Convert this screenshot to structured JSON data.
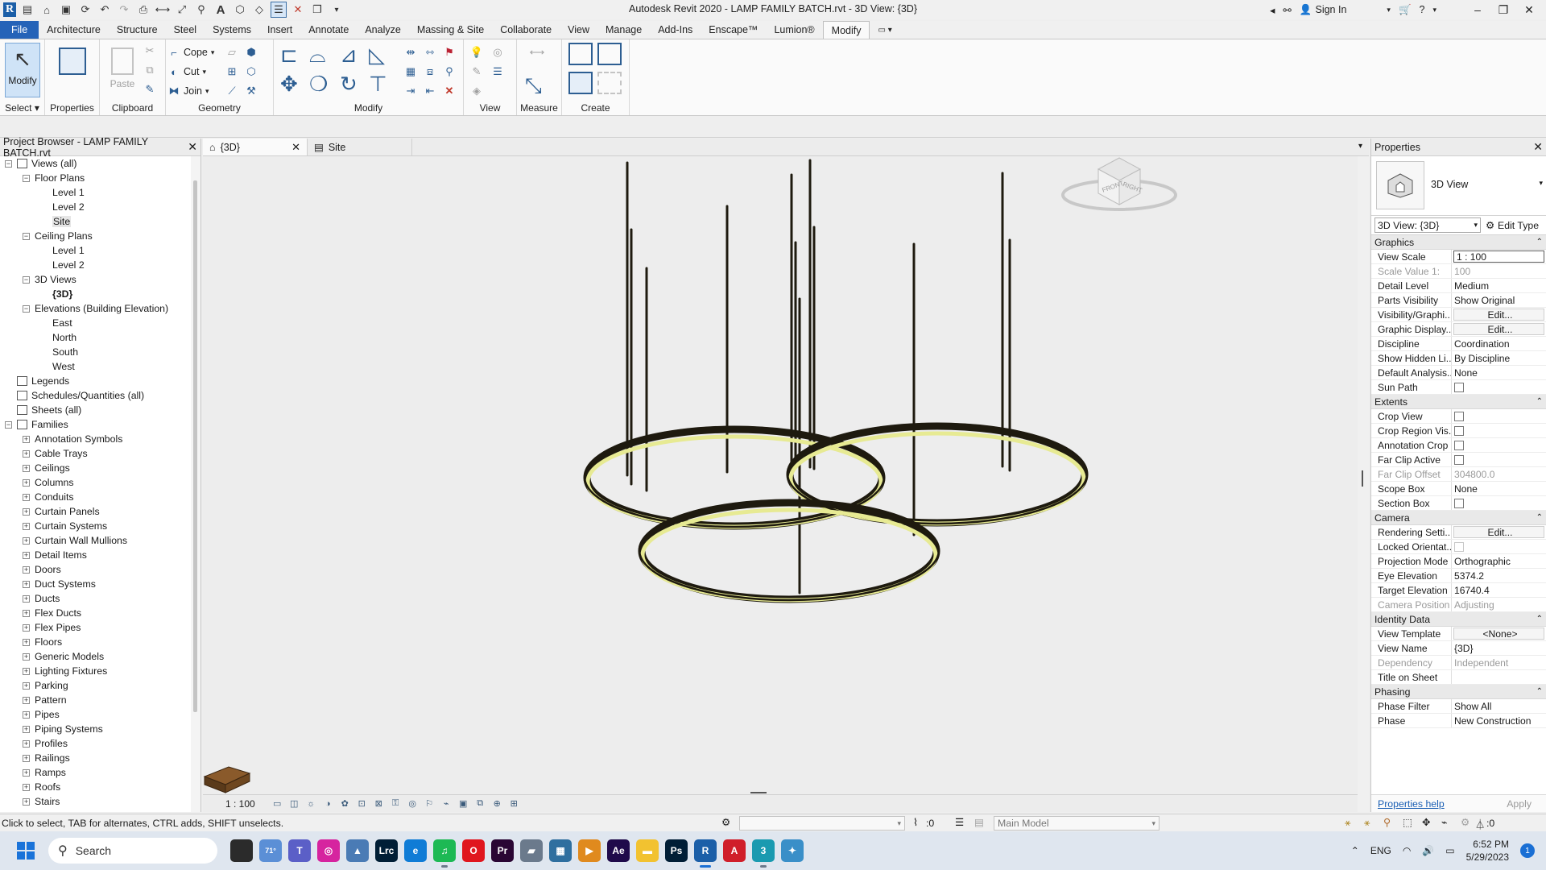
{
  "app": {
    "title": "Autodesk Revit 2020 - LAMP FAMILY BATCH.rvt - 3D View: {3D}",
    "sign_in": "Sign In"
  },
  "ribbon": {
    "tabs": [
      "File",
      "Architecture",
      "Structure",
      "Steel",
      "Systems",
      "Insert",
      "Annotate",
      "Analyze",
      "Massing & Site",
      "Collaborate",
      "View",
      "Manage",
      "Add-Ins",
      "Enscape™",
      "Lumion®",
      "Modify"
    ],
    "active_tab": "Modify",
    "select": {
      "button": "Modify",
      "label": "Select"
    },
    "properties": {
      "button": "Properties",
      "label": "Properties"
    },
    "clipboard": {
      "paste": "Paste",
      "label": "Clipboard"
    },
    "geometry": {
      "cope": "Cope",
      "cut": "Cut",
      "join": "Join",
      "label": "Geometry"
    },
    "modify_label": "Modify",
    "view_label": "View",
    "measure_label": "Measure",
    "create_label": "Create"
  },
  "browser": {
    "title": "Project Browser - LAMP FAMILY BATCH.rvt",
    "nodes": [
      {
        "label": "Views (all)",
        "depth": 0,
        "toggle": "−",
        "icon": true
      },
      {
        "label": "Floor Plans",
        "depth": 1,
        "toggle": "−"
      },
      {
        "label": "Level 1",
        "depth": 2
      },
      {
        "label": "Level 2",
        "depth": 2
      },
      {
        "label": "Site",
        "depth": 2,
        "selected": true
      },
      {
        "label": "Ceiling Plans",
        "depth": 1,
        "toggle": "−"
      },
      {
        "label": "Level 1",
        "depth": 2
      },
      {
        "label": "Level 2",
        "depth": 2
      },
      {
        "label": "3D Views",
        "depth": 1,
        "toggle": "−"
      },
      {
        "label": "{3D}",
        "depth": 2,
        "bold": true
      },
      {
        "label": "Elevations (Building Elevation)",
        "depth": 1,
        "toggle": "−"
      },
      {
        "label": "East",
        "depth": 2
      },
      {
        "label": "North",
        "depth": 2
      },
      {
        "label": "South",
        "depth": 2
      },
      {
        "label": "West",
        "depth": 2
      },
      {
        "label": "Legends",
        "depth": 0,
        "icon": true
      },
      {
        "label": "Schedules/Quantities (all)",
        "depth": 0,
        "icon": true
      },
      {
        "label": "Sheets (all)",
        "depth": 0,
        "icon": true
      },
      {
        "label": "Families",
        "depth": 0,
        "toggle": "−",
        "icon": true
      },
      {
        "label": "Annotation Symbols",
        "depth": 1,
        "toggle": "+"
      },
      {
        "label": "Cable Trays",
        "depth": 1,
        "toggle": "+"
      },
      {
        "label": "Ceilings",
        "depth": 1,
        "toggle": "+"
      },
      {
        "label": "Columns",
        "depth": 1,
        "toggle": "+"
      },
      {
        "label": "Conduits",
        "depth": 1,
        "toggle": "+"
      },
      {
        "label": "Curtain Panels",
        "depth": 1,
        "toggle": "+"
      },
      {
        "label": "Curtain Systems",
        "depth": 1,
        "toggle": "+"
      },
      {
        "label": "Curtain Wall Mullions",
        "depth": 1,
        "toggle": "+"
      },
      {
        "label": "Detail Items",
        "depth": 1,
        "toggle": "+"
      },
      {
        "label": "Doors",
        "depth": 1,
        "toggle": "+"
      },
      {
        "label": "Duct Systems",
        "depth": 1,
        "toggle": "+"
      },
      {
        "label": "Ducts",
        "depth": 1,
        "toggle": "+"
      },
      {
        "label": "Flex Ducts",
        "depth": 1,
        "toggle": "+"
      },
      {
        "label": "Flex Pipes",
        "depth": 1,
        "toggle": "+"
      },
      {
        "label": "Floors",
        "depth": 1,
        "toggle": "+"
      },
      {
        "label": "Generic Models",
        "depth": 1,
        "toggle": "+"
      },
      {
        "label": "Lighting Fixtures",
        "depth": 1,
        "toggle": "+"
      },
      {
        "label": "Parking",
        "depth": 1,
        "toggle": "+"
      },
      {
        "label": "Pattern",
        "depth": 1,
        "toggle": "+"
      },
      {
        "label": "Pipes",
        "depth": 1,
        "toggle": "+"
      },
      {
        "label": "Piping Systems",
        "depth": 1,
        "toggle": "+"
      },
      {
        "label": "Profiles",
        "depth": 1,
        "toggle": "+"
      },
      {
        "label": "Railings",
        "depth": 1,
        "toggle": "+"
      },
      {
        "label": "Ramps",
        "depth": 1,
        "toggle": "+"
      },
      {
        "label": "Roofs",
        "depth": 1,
        "toggle": "+"
      },
      {
        "label": "Stairs",
        "depth": 1,
        "toggle": "+"
      }
    ]
  },
  "view_tabs": [
    {
      "label": "{3D}",
      "active": true
    },
    {
      "label": "Site",
      "active": false
    }
  ],
  "viewcube": {
    "front": "FRONT",
    "right": "RIGHT"
  },
  "view_control": {
    "scale": "1 : 100"
  },
  "properties": {
    "title": "Properties",
    "type_name": "3D View",
    "instance": "3D View: {3D}",
    "edit_type": "Edit Type",
    "groups": [
      {
        "name": "Graphics",
        "rows": [
          {
            "name": "View Scale",
            "value": "1 : 100",
            "kind": "boxed"
          },
          {
            "name": "Scale Value    1:",
            "value": "100",
            "kind": "dim"
          },
          {
            "name": "Detail Level",
            "value": "Medium"
          },
          {
            "name": "Parts Visibility",
            "value": "Show Original"
          },
          {
            "name": "Visibility/Graphi...",
            "value": "Edit...",
            "kind": "btn"
          },
          {
            "name": "Graphic Display...",
            "value": "Edit...",
            "kind": "btn"
          },
          {
            "name": "Discipline",
            "value": "Coordination"
          },
          {
            "name": "Show Hidden Li...",
            "value": "By Discipline"
          },
          {
            "name": "Default Analysis...",
            "value": "None"
          },
          {
            "name": "Sun Path",
            "value": "",
            "kind": "check"
          }
        ]
      },
      {
        "name": "Extents",
        "rows": [
          {
            "name": "Crop View",
            "value": "",
            "kind": "check"
          },
          {
            "name": "Crop Region Vis...",
            "value": "",
            "kind": "check"
          },
          {
            "name": "Annotation Crop",
            "value": "",
            "kind": "check"
          },
          {
            "name": "Far Clip Active",
            "value": "",
            "kind": "check"
          },
          {
            "name": "Far Clip Offset",
            "value": "304800.0",
            "kind": "dim"
          },
          {
            "name": "Scope Box",
            "value": "None"
          },
          {
            "name": "Section Box",
            "value": "",
            "kind": "check"
          }
        ]
      },
      {
        "name": "Camera",
        "rows": [
          {
            "name": "Rendering Setti...",
            "value": "Edit...",
            "kind": "btn"
          },
          {
            "name": "Locked Orientat...",
            "value": "",
            "kind": "checkdim"
          },
          {
            "name": "Projection Mode",
            "value": "Orthographic"
          },
          {
            "name": "Eye Elevation",
            "value": "5374.2"
          },
          {
            "name": "Target Elevation",
            "value": "16740.4"
          },
          {
            "name": "Camera Position",
            "value": "Adjusting",
            "kind": "dim"
          }
        ]
      },
      {
        "name": "Identity Data",
        "rows": [
          {
            "name": "View Template",
            "value": "<None>",
            "kind": "btn"
          },
          {
            "name": "View Name",
            "value": "{3D}"
          },
          {
            "name": "Dependency",
            "value": "Independent",
            "kind": "dim"
          },
          {
            "name": "Title on Sheet",
            "value": ""
          }
        ]
      },
      {
        "name": "Phasing",
        "rows": [
          {
            "name": "Phase Filter",
            "value": "Show All"
          },
          {
            "name": "Phase",
            "value": "New Construction"
          }
        ]
      }
    ],
    "help": "Properties help",
    "apply": "Apply"
  },
  "status": {
    "hint": "Click to select, TAB for alternates, CTRL adds, SHIFT unselects.",
    "selection_count": ":0",
    "model": "Main Model",
    "filter_count": ":0"
  },
  "taskbar": {
    "search": "Search",
    "apps": [
      {
        "name": "file-explorer-app-icon",
        "label": "",
        "color": "#2b2b2b"
      },
      {
        "name": "weather-app-icon",
        "label": "71°",
        "color": "#5b8fd6"
      },
      {
        "name": "teams-app-icon",
        "label": "T",
        "color": "#5b5fc7"
      },
      {
        "name": "instagram-app-icon",
        "label": "◎",
        "color": "#d6249f"
      },
      {
        "name": "chart-app-icon",
        "label": "▲",
        "color": "#4a7bb5"
      },
      {
        "name": "lightroom-app-icon",
        "label": "Lrc",
        "color": "#001e36"
      },
      {
        "name": "edge-app-icon",
        "label": "e",
        "color": "#0f7cd6"
      },
      {
        "name": "spotify-app-icon",
        "label": "♫",
        "color": "#1db954"
      },
      {
        "name": "opera-app-icon",
        "label": "O",
        "color": "#e0161e"
      },
      {
        "name": "premiere-app-icon",
        "label": "Pr",
        "color": "#2a0634"
      },
      {
        "name": "sketchup-app-icon",
        "label": "▰",
        "color": "#6b7a8c"
      },
      {
        "name": "calculator-app-icon",
        "label": "▦",
        "color": "#2f6f9f"
      },
      {
        "name": "media-app-icon",
        "label": "▶",
        "color": "#e08a1e"
      },
      {
        "name": "after-effects-app-icon",
        "label": "Ae",
        "color": "#1f0a4a"
      },
      {
        "name": "folder-app-icon",
        "label": "▬",
        "color": "#f2c230"
      },
      {
        "name": "photoshop-app-icon",
        "label": "Ps",
        "color": "#001e36"
      },
      {
        "name": "revit-app-icon",
        "label": "R",
        "color": "#1b5fa8"
      },
      {
        "name": "autocad-app-icon",
        "label": "A",
        "color": "#d01e2a"
      },
      {
        "name": "3dsmax-app-icon",
        "label": "3",
        "color": "#1a9ab0"
      },
      {
        "name": "network-app-icon",
        "label": "✦",
        "color": "#3a8fc8"
      }
    ],
    "language": "ENG",
    "time": "6:52 PM",
    "date": "5/29/2023",
    "notifications": "1"
  },
  "colors": {
    "accent": "#2563b8",
    "ring_light": "#e7ea93",
    "ring_dark": "#1e1a0f",
    "viewport_bg": "#ededed"
  }
}
